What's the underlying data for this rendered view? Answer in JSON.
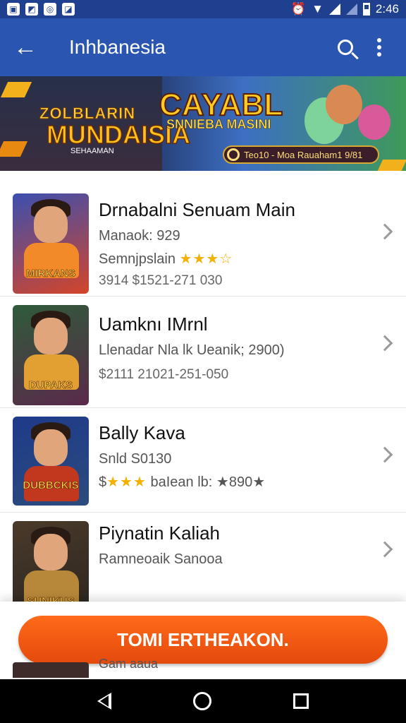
{
  "status_bar": {
    "time": "2:46",
    "icons": [
      "photo-icon",
      "cast-icon",
      "instagram-icon",
      "gallery-icon"
    ]
  },
  "app_bar": {
    "title": "Inhbanesia",
    "back_icon": "back-arrow-icon",
    "search_icon": "search-icon",
    "menu_icon": "more-vert-icon"
  },
  "banner": {
    "left_top": "ZOLBLARIN",
    "left_title": "MUNDAISIA",
    "left_sub": "SEHAAMAN",
    "right_title": "CAYABL",
    "right_line": "SNNIEBA MASINI",
    "pill_text": "Teo10 - Moa Rauaham1 9/81"
  },
  "games": [
    {
      "title": "Drnabalni Senuam Main",
      "line1": "Manaok: 929",
      "line2_text": "Semnjpslain",
      "line2_stars": "★★★☆",
      "line2_suffix": "",
      "line3": "3914 $1521-271 030",
      "palette": [
        "#3b4fb0",
        "#f28a2a",
        "#d3452a"
      ],
      "caption": "MIRKANS"
    },
    {
      "title": "Uamknı IMrnl",
      "line1": "Llenadar Nla lk Ueanik; 2900)",
      "line2_text": "",
      "line2_stars": "",
      "line2_suffix": "",
      "line3": "$2111 21021-251-050",
      "palette": [
        "#2f5b3a",
        "#e2a033",
        "#5a2a4a"
      ],
      "caption": "DUPAKS"
    },
    {
      "title": "Bally Kava",
      "line1": "Snld S0130",
      "line2_text": "$",
      "line2_stars": "★★★",
      "line2_suffix": "baIean lb: ★890★",
      "line3": "",
      "palette": [
        "#1e3a8a",
        "#c2381f",
        "#2b4c7c"
      ],
      "caption": "DUBBCKIS"
    },
    {
      "title": "Piynatin Kaliah",
      "line1": "Ramneoaik Sanooa",
      "line2_text": "",
      "line2_stars": "",
      "line2_suffix": "",
      "line3": "",
      "palette": [
        "#4a3a2a",
        "#b8883a",
        "#2a2420"
      ],
      "caption": "SUNIKUS"
    }
  ],
  "peek_text": "Gam aaua",
  "cta": {
    "label": "TOMI ERTHEAKON."
  },
  "nav": {
    "back": "nav-back-icon",
    "home": "nav-home-icon",
    "recents": "nav-recents-icon"
  },
  "colors": {
    "status_bar": "#1f3f8f",
    "app_bar": "#2a56b2",
    "cta": "#f25a14",
    "stars": "#f2b000"
  }
}
